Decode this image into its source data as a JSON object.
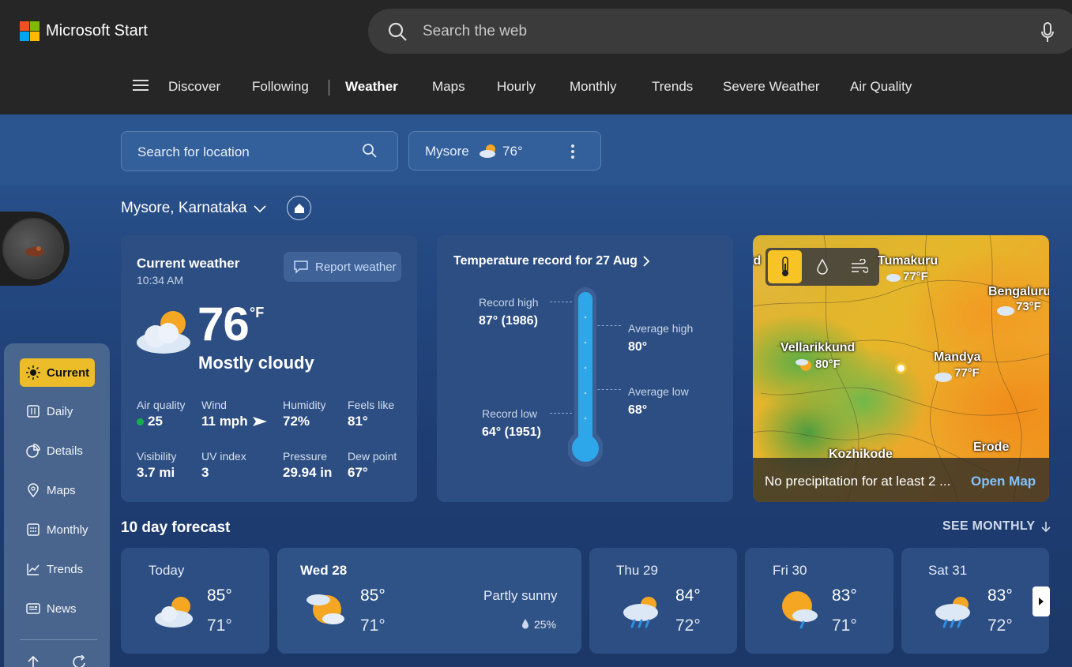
{
  "app": {
    "name": "Microsoft Start"
  },
  "websearch": {
    "placeholder": "Search the web"
  },
  "nav": {
    "items": [
      "Discover",
      "Following",
      "Weather",
      "Maps",
      "Hourly",
      "Monthly",
      "Trends",
      "Severe Weather",
      "Air Quality"
    ],
    "active": "Weather"
  },
  "location_bar": {
    "search_placeholder": "Search for location",
    "favorite_city": "Mysore",
    "favorite_temp": "76°"
  },
  "location": {
    "title": "Mysore, Karnataka"
  },
  "sidebar": {
    "items": [
      "Current",
      "Daily",
      "Details",
      "Maps",
      "Monthly",
      "Trends",
      "News"
    ],
    "active": "Current"
  },
  "current": {
    "title": "Current weather",
    "time": "10:34 AM",
    "report_label": "Report weather",
    "temp": "76",
    "unit": "°F",
    "condition": "Mostly cloudy",
    "stats": [
      {
        "label": "Air quality",
        "value": "25"
      },
      {
        "label": "Wind",
        "value": "11 mph"
      },
      {
        "label": "Humidity",
        "value": "72%"
      },
      {
        "label": "Feels like",
        "value": "81°"
      },
      {
        "label": "Visibility",
        "value": "3.7 mi"
      },
      {
        "label": "UV index",
        "value": "3"
      },
      {
        "label": "Pressure",
        "value": "29.94 in"
      },
      {
        "label": "Dew point",
        "value": "67°"
      }
    ],
    "air_quality_color": "#13b14e"
  },
  "record": {
    "title": "Temperature record for 27 Aug",
    "record_high_label": "Record high",
    "record_high_value": "87° (1986)",
    "avg_high_label": "Average high",
    "avg_high_value": "80°",
    "avg_low_label": "Average low",
    "avg_low_value": "68°",
    "record_low_label": "Record low",
    "record_low_value": "64° (1951)"
  },
  "map": {
    "cities": [
      {
        "name": "Tumakuru",
        "temp": "77°F"
      },
      {
        "name": "Bengaluru",
        "temp": "73°F"
      },
      {
        "name": "Vellarikkund",
        "temp": "80°F"
      },
      {
        "name": "Mandya",
        "temp": "77°F"
      },
      {
        "name": "Kozhikode",
        "temp": ""
      },
      {
        "name": "Erode",
        "temp": ""
      }
    ],
    "edge_label": "ld",
    "summary": "No precipitation for at least 2 ...",
    "open_label": "Open Map"
  },
  "forecast": {
    "title": "10 day forecast",
    "see_monthly": "SEE MONTHLY",
    "days": [
      {
        "day": "Today",
        "hi": "85°",
        "lo": "71°",
        "icon": "mostly-cloudy-icon"
      },
      {
        "day": "Wed 28",
        "hi": "85°",
        "lo": "71°",
        "icon": "partly-sunny-icon",
        "condition": "Partly sunny",
        "precip": "25%"
      },
      {
        "day": "Thu 29",
        "hi": "84°",
        "lo": "72°",
        "icon": "rain-showers-icon"
      },
      {
        "day": "Fri 30",
        "hi": "83°",
        "lo": "71°",
        "icon": "sun-showers-icon"
      },
      {
        "day": "Sat 31",
        "hi": "83°",
        "lo": "72°",
        "icon": "rain-showers-icon"
      }
    ]
  },
  "colors": {
    "accent": "#f7c325",
    "link": "#7fc4ff",
    "card": "#2d4e82"
  }
}
